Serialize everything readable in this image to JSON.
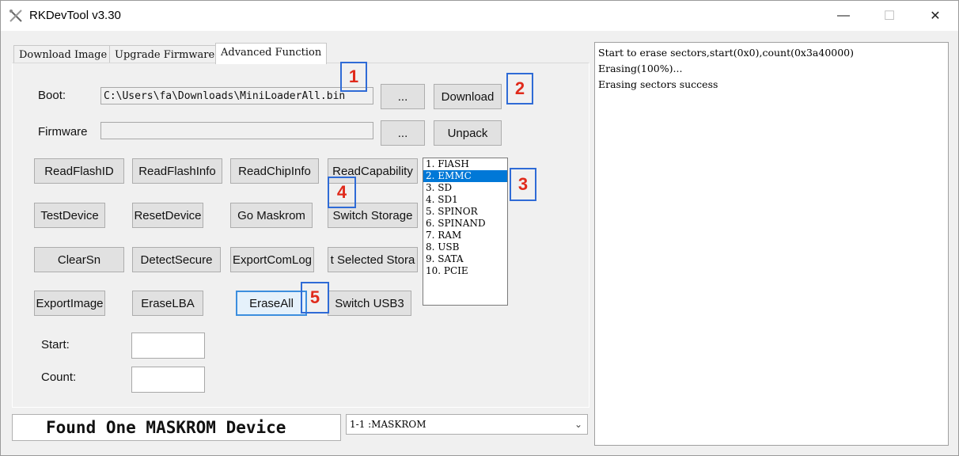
{
  "window": {
    "title": "RKDevTool v3.30"
  },
  "tabs": [
    {
      "label": "Download Image"
    },
    {
      "label": "Upgrade Firmware"
    },
    {
      "label": "Advanced Function"
    }
  ],
  "boot": {
    "label": "Boot:",
    "value": "C:\\Users\\fa\\Downloads\\MiniLoaderAll.bin",
    "browse": "...",
    "action": "Download"
  },
  "firmware": {
    "label": "Firmware",
    "value": "",
    "browse": "...",
    "action": "Unpack"
  },
  "buttons": {
    "read_flash_id": "ReadFlashID",
    "read_flash_info": "ReadFlashInfo",
    "read_chip_info": "ReadChipInfo",
    "read_capability": "ReadCapability",
    "test_device": "TestDevice",
    "reset_device": "ResetDevice",
    "go_maskrom": "Go Maskrom",
    "switch_storage": "Switch Storage",
    "clear_sn": "ClearSn",
    "detect_secure": "DetectSecure",
    "export_com_log": "ExportComLog",
    "get_selected_storage": "t Selected Stora",
    "export_image": "ExportImage",
    "erase_lba": "EraseLBA",
    "erase_all": "EraseAll",
    "switch_usb3": "Switch USB3"
  },
  "start": {
    "label": "Start:",
    "value": ""
  },
  "count": {
    "label": "Count:",
    "value": ""
  },
  "storage_list": [
    {
      "label": "1. FlASH",
      "selected": false
    },
    {
      "label": "2. EMMC",
      "selected": true
    },
    {
      "label": "3. SD",
      "selected": false
    },
    {
      "label": "4. SD1",
      "selected": false
    },
    {
      "label": "5. SPINOR",
      "selected": false
    },
    {
      "label": "6. SPINAND",
      "selected": false
    },
    {
      "label": "7. RAM",
      "selected": false
    },
    {
      "label": "8. USB",
      "selected": false
    },
    {
      "label": "9. SATA",
      "selected": false
    },
    {
      "label": "10. PCIE",
      "selected": false
    }
  ],
  "markers": [
    "1",
    "2",
    "3",
    "4",
    "5"
  ],
  "status": {
    "text": "Found One MASKROM Device"
  },
  "device_select": {
    "value": "1-1 :MASKROM"
  },
  "log": [
    "Start to erase sectors,start(0x0),count(0x3a40000)",
    "Erasing(100%)...",
    "Erasing sectors success"
  ],
  "colors": {
    "selection": "#0078d7",
    "marker_border": "#2f6bd6",
    "marker_text": "#e02a1b",
    "focus_border": "#3c8ede"
  },
  "icons": {
    "app": "tools-icon",
    "minimize": "minimize-icon",
    "maximize": "maximize-icon",
    "close": "close-icon",
    "dropdown": "chevron-down-icon"
  }
}
